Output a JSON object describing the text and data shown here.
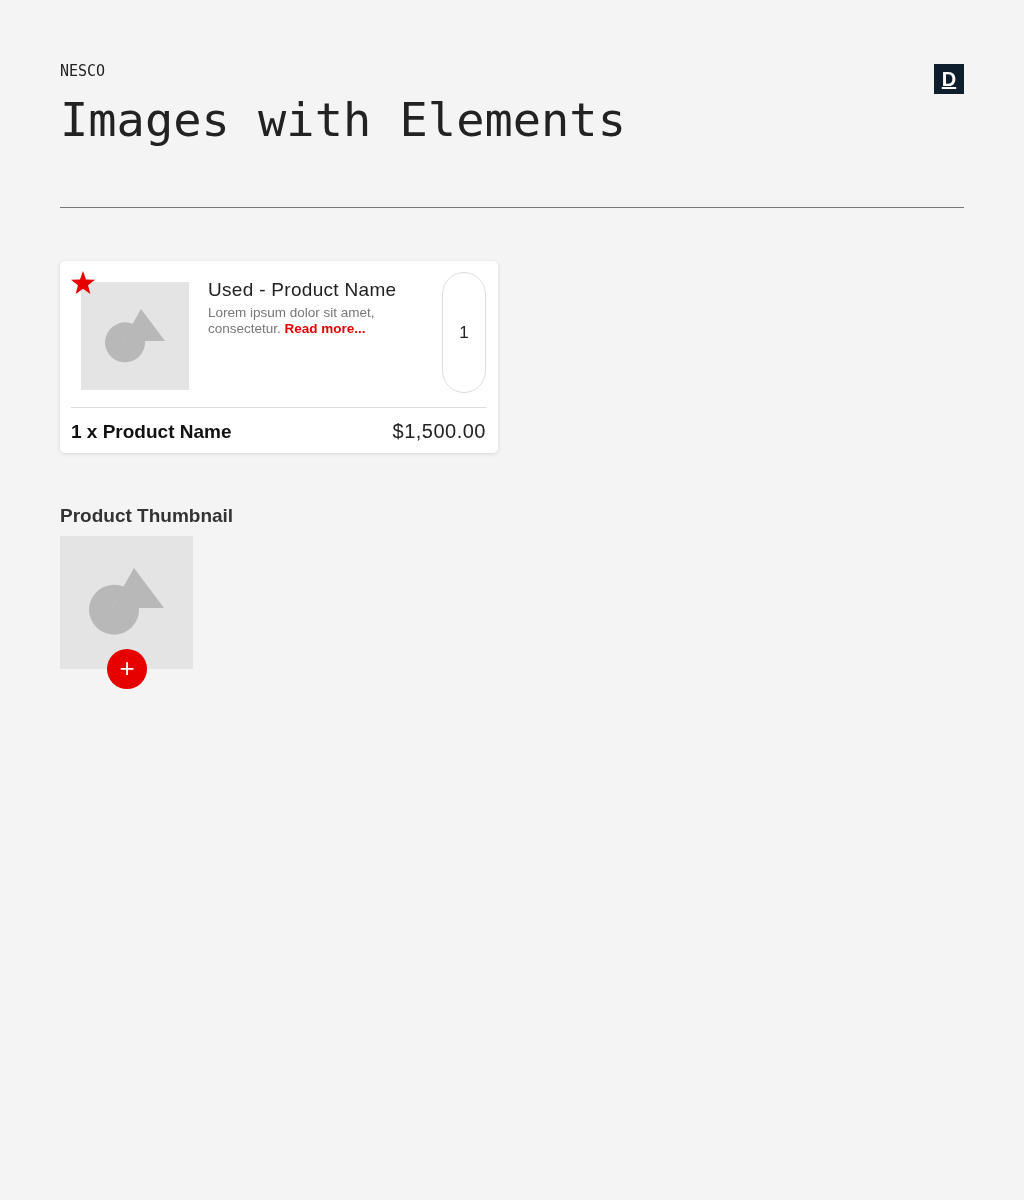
{
  "header": {
    "brand": "NESCO",
    "title": "Images with Elements",
    "logo": "D"
  },
  "product_card": {
    "favorite": true,
    "title": "Used - Product Name",
    "description": "Lorem ipsum dolor sit amet, consectetur.",
    "link": "Read more...",
    "quantity": "1",
    "summary": "1 x Product Name",
    "price": "$1,500.00"
  },
  "thumbnail_section": {
    "heading": "Product Thumbnail",
    "action": "+"
  }
}
